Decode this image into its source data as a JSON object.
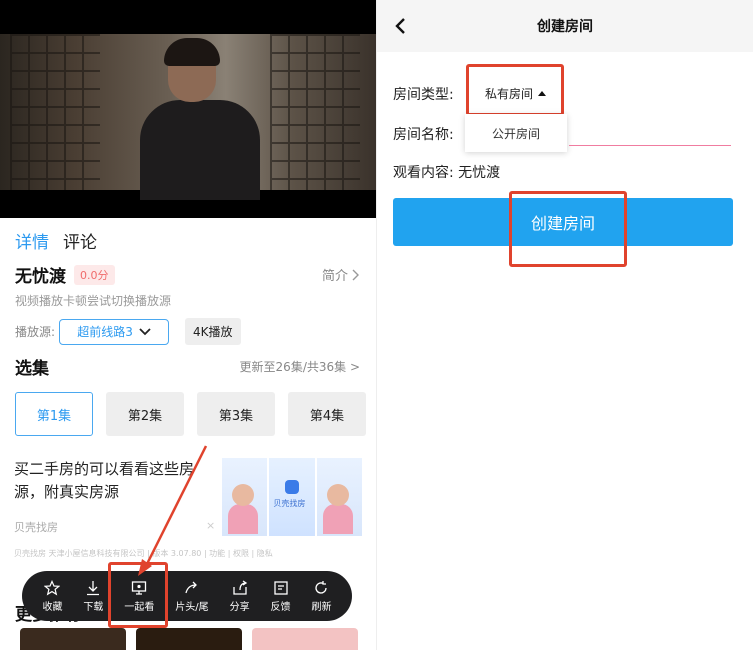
{
  "left": {
    "tabs": {
      "details": "详情",
      "comments": "评论"
    },
    "show": {
      "title": "无忧渡",
      "score": "0.0分",
      "intro": "简介"
    },
    "hint": "视频播放卡顿尝试切换播放源",
    "source": {
      "label": "播放源:",
      "selected": "超前线路3",
      "quality": "4K播放"
    },
    "episodes": {
      "title": "选集",
      "update": "更新至26集/共36集 >",
      "items": [
        "第1集",
        "第2集",
        "第3集",
        "第4集"
      ]
    },
    "ad": {
      "text": "买二手房的可以看看这些房源，附真实房源",
      "source": "贝壳找房",
      "close": "×",
      "logo_text": "贝壳找房",
      "legal": "贝壳找房 天津小屋信息科技有限公司 | 版本 3.07.80 | 功能 | 权限 | 隐私"
    },
    "more": "更多推荐",
    "toolbar": [
      "收藏",
      "下载",
      "一起看",
      "片头/尾",
      "分享",
      "反馈",
      "刷新"
    ]
  },
  "right": {
    "header_title": "创建房间",
    "type_label": "房间类型:",
    "type_value": "私有房间",
    "dropdown_option": "公开房间",
    "name_label": "房间名称:",
    "content_label": "观看内容:",
    "content_value": "无忧渡",
    "create_button": "创建房间"
  },
  "colors": {
    "accent": "#21a3ef",
    "highlight": "#e0432d",
    "toolbar_bg": "#1f1f21"
  }
}
